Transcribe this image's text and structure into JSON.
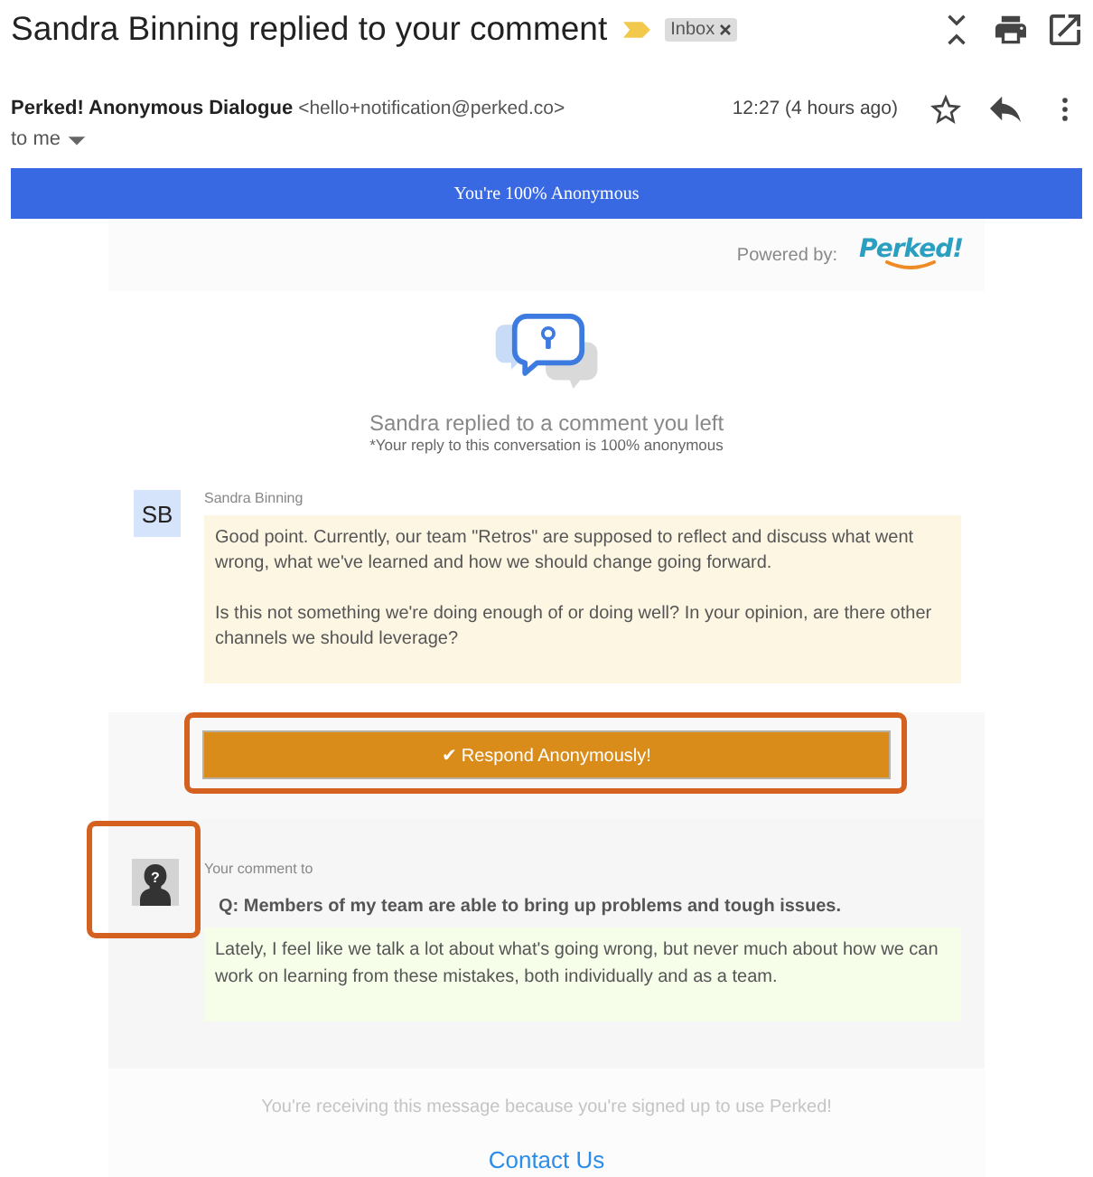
{
  "header": {
    "subject": "Sandra Binning replied to your comment",
    "important": true,
    "labels": [
      {
        "text": "Inbox"
      }
    ]
  },
  "sender": {
    "name": "Perked! Anonymous Dialogue",
    "email": "<hello+notification@perked.co>",
    "time": "12:27 (4 hours ago)",
    "recipient": "to me",
    "starred": false
  },
  "banner": {
    "text": "You're 100% Anonymous"
  },
  "powered_by": {
    "label": "Powered by:",
    "logo": "Perked!"
  },
  "intro": {
    "title": "Sandra replied to a comment you left",
    "note": "*Your reply to this conversation is 100% anonymous"
  },
  "reply": {
    "initials": "SB",
    "author": "Sandra Binning",
    "paragraphs": [
      "Good point. Currently, our team \"Retros\" are supposed to reflect and discuss what went wrong, what we've learned and how we should change going forward.",
      "Is this not something we're doing enough of or doing well? In your opinion, are there other channels we should leverage?"
    ]
  },
  "respond_button": {
    "label": "✔ Respond Anonymously!",
    "highlighted": true
  },
  "comment": {
    "avatar_symbol": "?",
    "avatar_highlighted": true,
    "caption": "Your comment to",
    "question": "Q: Members of my team are able to bring up problems and tough issues.",
    "text": "Lately, I feel like we talk a lot about what's going wrong, but never much about how we can work on learning from these mistakes, both individually and as a team."
  },
  "footer": {
    "notice": "You're receiving this message because you're signed up to use Perked!",
    "link": "Contact Us"
  }
}
